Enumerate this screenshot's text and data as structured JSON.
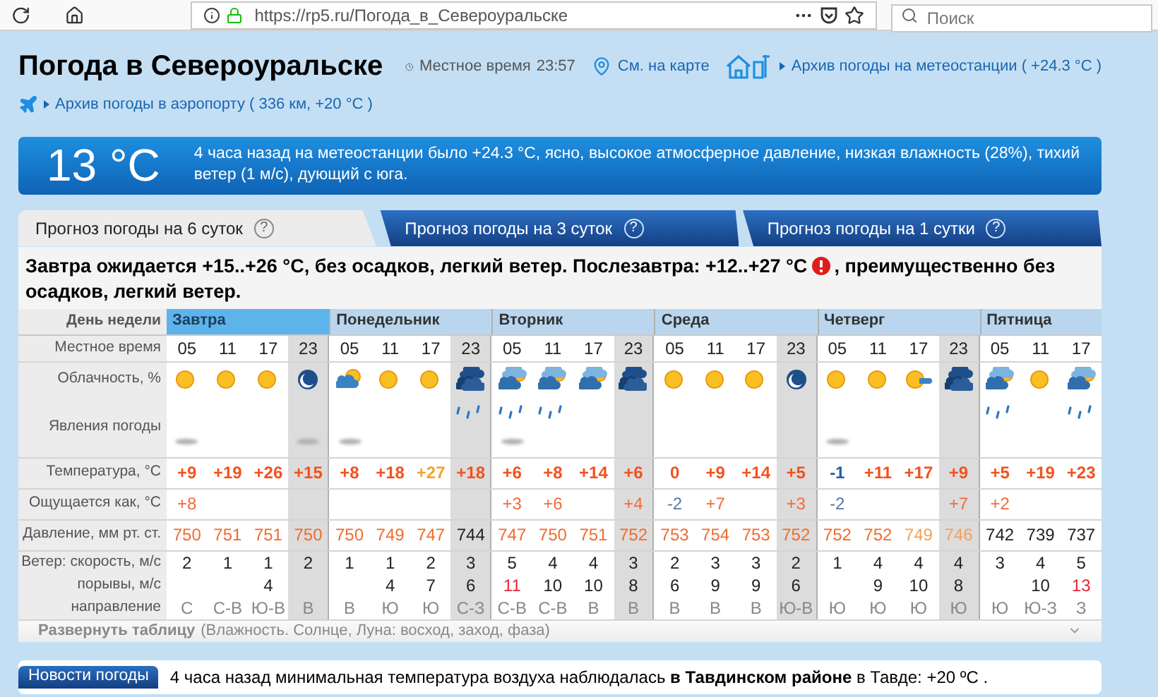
{
  "browser": {
    "url": "https://rp5.ru/Погода_в_Североуральске",
    "search": {
      "placeholder": "Поиск"
    }
  },
  "header": {
    "title": "Погода в Североуральске",
    "local_time_label": "Местное время",
    "local_time": "23:57",
    "map_link": "См. на карте",
    "station_archive_link": "Архив погоды на метеостанции ( +24.3 °C )",
    "airport_archive_link": "Архив погоды в аэропорту ( 336 км, +20 °C )"
  },
  "current": {
    "temperature": "13 °C",
    "description": "4 часа назад на метеостанции было +24.3 °C, ясно, высокое атмосферное давление, низкая влажность (28%), тихий ветер (1 м/с), дующий с юга."
  },
  "tabs": [
    {
      "label": "Прогноз погоды на 6 суток",
      "help": "?",
      "selected": true
    },
    {
      "label": "Прогноз погоды на 3 суток",
      "help": "?",
      "selected": false
    },
    {
      "label": "Прогноз погоды на 1 сутки",
      "help": "?",
      "selected": false
    }
  ],
  "forecast_summary": {
    "before_warning": "Завтра ожидается +15..+26 °C, без осадков, легкий ветер. Послезавтра: +12..+27 °C",
    "warning": true,
    "after_warning": ", преимущественно без",
    "continuation": "осадков, легкий ветер."
  },
  "table": {
    "row_labels": [
      "День недели",
      "Местное время",
      "Облачность, %",
      "Явления погоды",
      "Температура, °C",
      "Ощущается как, °C",
      "Давление, мм рт. ст.",
      "Ветер: скорость, м/с",
      "порывы, м/с",
      "направление"
    ],
    "days": [
      {
        "name": "Завтра",
        "selected": true,
        "slots": [
          {
            "time": "05",
            "night": false,
            "sky": {
              "kind": "sun"
            },
            "weather": {
              "kind": "haze"
            },
            "temperature": {
              "text": "+9",
              "color": "#f4511e"
            },
            "feels": {
              "text": "+8",
              "color": "#f26b3a"
            },
            "pressure": {
              "text": "750",
              "color": "#f26b2d"
            },
            "wind": "2",
            "direction": "С"
          },
          {
            "time": "11",
            "night": false,
            "sky": {
              "kind": "sun"
            },
            "temperature": {
              "text": "+19",
              "color": "#f4511e"
            },
            "pressure": {
              "text": "751",
              "color": "#f26b2d"
            },
            "wind": "1",
            "direction": "С-В"
          },
          {
            "time": "17",
            "night": false,
            "sky": {
              "kind": "sun"
            },
            "temperature": {
              "text": "+26",
              "color": "#f4511e"
            },
            "pressure": {
              "text": "751",
              "color": "#f26b2d"
            },
            "wind": "1",
            "gust": {
              "text": "4",
              "color": "#222222"
            },
            "direction": "Ю-В"
          },
          {
            "time": "23",
            "night": true,
            "sky": {
              "kind": "moon"
            },
            "weather": {
              "kind": "haze"
            },
            "temperature": {
              "text": "+15",
              "color": "#f4511e"
            },
            "pressure": {
              "text": "750",
              "color": "#f26b2d"
            },
            "wind": "2",
            "direction": "В"
          }
        ]
      },
      {
        "name": "Понедельник",
        "selected": false,
        "slots": [
          {
            "time": "05",
            "night": false,
            "sky": {
              "kind": "partly"
            },
            "weather": {
              "kind": "haze"
            },
            "temperature": {
              "text": "+8",
              "color": "#f4511e"
            },
            "pressure": {
              "text": "750",
              "color": "#f26b2d"
            },
            "wind": "1",
            "direction": "В"
          },
          {
            "time": "11",
            "night": false,
            "sky": {
              "kind": "sun"
            },
            "temperature": {
              "text": "+18",
              "color": "#f4511e"
            },
            "pressure": {
              "text": "749",
              "color": "#f26b2d"
            },
            "wind": "1",
            "gust": {
              "text": "4",
              "color": "#222222"
            },
            "direction": "Ю"
          },
          {
            "time": "17",
            "night": false,
            "sky": {
              "kind": "sun"
            },
            "temperature": {
              "text": "+27",
              "color": "#f7a130"
            },
            "pressure": {
              "text": "747",
              "color": "#f26b2d"
            },
            "wind": "2",
            "gust": {
              "text": "7",
              "color": "#222222"
            },
            "direction": "Ю"
          },
          {
            "time": "23",
            "night": true,
            "sky": {
              "kind": "overcast"
            },
            "weather": {
              "kind": "rain"
            },
            "temperature": {
              "text": "+18",
              "color": "#f4511e"
            },
            "pressure": {
              "text": "744",
              "color": "#222222"
            },
            "wind": "3",
            "gust": {
              "text": "6",
              "color": "#222222"
            },
            "direction": "С-З"
          }
        ]
      },
      {
        "name": "Вторник",
        "selected": false,
        "slots": [
          {
            "time": "05",
            "night": false,
            "sky": {
              "kind": "cloudy"
            },
            "weather": {
              "kind": "rain-haze"
            },
            "temperature": {
              "text": "+6",
              "color": "#f4511e"
            },
            "feels": {
              "text": "+3",
              "color": "#f26b3a"
            },
            "pressure": {
              "text": "747",
              "color": "#f26b2d"
            },
            "wind": "5",
            "gust": {
              "text": "11",
              "color": "#e8253a"
            },
            "direction": "С-В"
          },
          {
            "time": "11",
            "night": false,
            "sky": {
              "kind": "cloudy"
            },
            "weather": {
              "kind": "rain"
            },
            "temperature": {
              "text": "+8",
              "color": "#f4511e"
            },
            "feels": {
              "text": "+6",
              "color": "#f26b3a"
            },
            "pressure": {
              "text": "750",
              "color": "#f26b2d"
            },
            "wind": "4",
            "gust": {
              "text": "10",
              "color": "#222222"
            },
            "direction": "С-В"
          },
          {
            "time": "17",
            "night": false,
            "sky": {
              "kind": "cloudy"
            },
            "temperature": {
              "text": "+14",
              "color": "#f4511e"
            },
            "pressure": {
              "text": "751",
              "color": "#f26b2d"
            },
            "wind": "4",
            "gust": {
              "text": "10",
              "color": "#222222"
            },
            "direction": "В"
          },
          {
            "time": "23",
            "night": true,
            "sky": {
              "kind": "overcast"
            },
            "temperature": {
              "text": "+6",
              "color": "#f4511e"
            },
            "feels": {
              "text": "+4",
              "color": "#f26b3a"
            },
            "pressure": {
              "text": "752",
              "color": "#f26b2d"
            },
            "wind": "3",
            "gust": {
              "text": "8",
              "color": "#222222"
            },
            "direction": "В"
          }
        ]
      },
      {
        "name": "Среда",
        "selected": false,
        "slots": [
          {
            "time": "05",
            "night": false,
            "sky": {
              "kind": "sun"
            },
            "temperature": {
              "text": "0",
              "color": "#f4511e"
            },
            "feels": {
              "text": "-2",
              "color": "#5577aa"
            },
            "pressure": {
              "text": "753",
              "color": "#f26b2d"
            },
            "wind": "2",
            "gust": {
              "text": "6",
              "color": "#222222"
            },
            "direction": "В"
          },
          {
            "time": "11",
            "night": false,
            "sky": {
              "kind": "sun"
            },
            "temperature": {
              "text": "+9",
              "color": "#f4511e"
            },
            "feels": {
              "text": "+7",
              "color": "#f26b3a"
            },
            "pressure": {
              "text": "754",
              "color": "#f26b2d"
            },
            "wind": "3",
            "gust": {
              "text": "9",
              "color": "#222222"
            },
            "direction": "В"
          },
          {
            "time": "17",
            "night": false,
            "sky": {
              "kind": "sun"
            },
            "temperature": {
              "text": "+14",
              "color": "#f4511e"
            },
            "pressure": {
              "text": "753",
              "color": "#f26b2d"
            },
            "wind": "3",
            "gust": {
              "text": "9",
              "color": "#222222"
            },
            "direction": "В"
          },
          {
            "time": "23",
            "night": true,
            "sky": {
              "kind": "moon"
            },
            "temperature": {
              "text": "+5",
              "color": "#f4511e"
            },
            "feels": {
              "text": "+3",
              "color": "#f26b3a"
            },
            "pressure": {
              "text": "752",
              "color": "#f26b2d"
            },
            "wind": "2",
            "gust": {
              "text": "6",
              "color": "#222222"
            },
            "direction": "Ю-В"
          }
        ]
      },
      {
        "name": "Четверг",
        "selected": false,
        "slots": [
          {
            "time": "05",
            "night": false,
            "sky": {
              "kind": "sun"
            },
            "weather": {
              "kind": "haze"
            },
            "temperature": {
              "text": "-1",
              "color": "#1d5fa8"
            },
            "feels": {
              "text": "-2",
              "color": "#5577aa"
            },
            "pressure": {
              "text": "752",
              "color": "#f26b2d"
            },
            "wind": "1",
            "direction": "Ю"
          },
          {
            "time": "11",
            "night": false,
            "sky": {
              "kind": "sun"
            },
            "temperature": {
              "text": "+11",
              "color": "#f4511e"
            },
            "pressure": {
              "text": "752",
              "color": "#f26b2d"
            },
            "wind": "4",
            "gust": {
              "text": "9",
              "color": "#222222"
            },
            "direction": "Ю"
          },
          {
            "time": "17",
            "night": false,
            "sky": {
              "kind": "sun-cloud"
            },
            "temperature": {
              "text": "+17",
              "color": "#f4511e"
            },
            "pressure": {
              "text": "749",
              "color": "#f4a05a"
            },
            "wind": "4",
            "gust": {
              "text": "10",
              "color": "#222222"
            },
            "direction": "Ю"
          },
          {
            "time": "23",
            "night": true,
            "sky": {
              "kind": "overcast"
            },
            "temperature": {
              "text": "+9",
              "color": "#f4511e"
            },
            "feels": {
              "text": "+7",
              "color": "#f26b3a"
            },
            "pressure": {
              "text": "746",
              "color": "#f4a05a"
            },
            "wind": "4",
            "gust": {
              "text": "8",
              "color": "#222222"
            },
            "direction": "Ю"
          }
        ]
      },
      {
        "name": "Пятница",
        "selected": false,
        "slots": [
          {
            "time": "05",
            "night": false,
            "sky": {
              "kind": "cloudy"
            },
            "weather": {
              "kind": "rain"
            },
            "temperature": {
              "text": "+5",
              "color": "#f4511e"
            },
            "feels": {
              "text": "+2",
              "color": "#f26b3a"
            },
            "pressure": {
              "text": "742",
              "color": "#222222"
            },
            "wind": "3",
            "direction": "Ю"
          },
          {
            "time": "11",
            "night": false,
            "sky": {
              "kind": "sun"
            },
            "temperature": {
              "text": "+19",
              "color": "#f4511e"
            },
            "pressure": {
              "text": "739",
              "color": "#222222"
            },
            "wind": "4",
            "gust": {
              "text": "10",
              "color": "#222222"
            },
            "direction": "Ю-З"
          },
          {
            "time": "17",
            "night": false,
            "sky": {
              "kind": "cloudy"
            },
            "weather": {
              "kind": "rain"
            },
            "temperature": {
              "text": "+23",
              "color": "#f4511e"
            },
            "pressure": {
              "text": "737",
              "color": "#222222"
            },
            "wind": "5",
            "gust": {
              "text": "13",
              "color": "#e8253a"
            },
            "direction": "З"
          }
        ]
      }
    ]
  },
  "expand": {
    "label": "Развернуть таблицу",
    "details": "(Влажность. Солнце, Луна: восход, заход, фаза)"
  },
  "news": {
    "badge": "Новости погоды",
    "text": "4 часа назад минимальная температура воздуха наблюдалась **в Тавдинском районе** в Тавде: +20 ºC ."
  }
}
